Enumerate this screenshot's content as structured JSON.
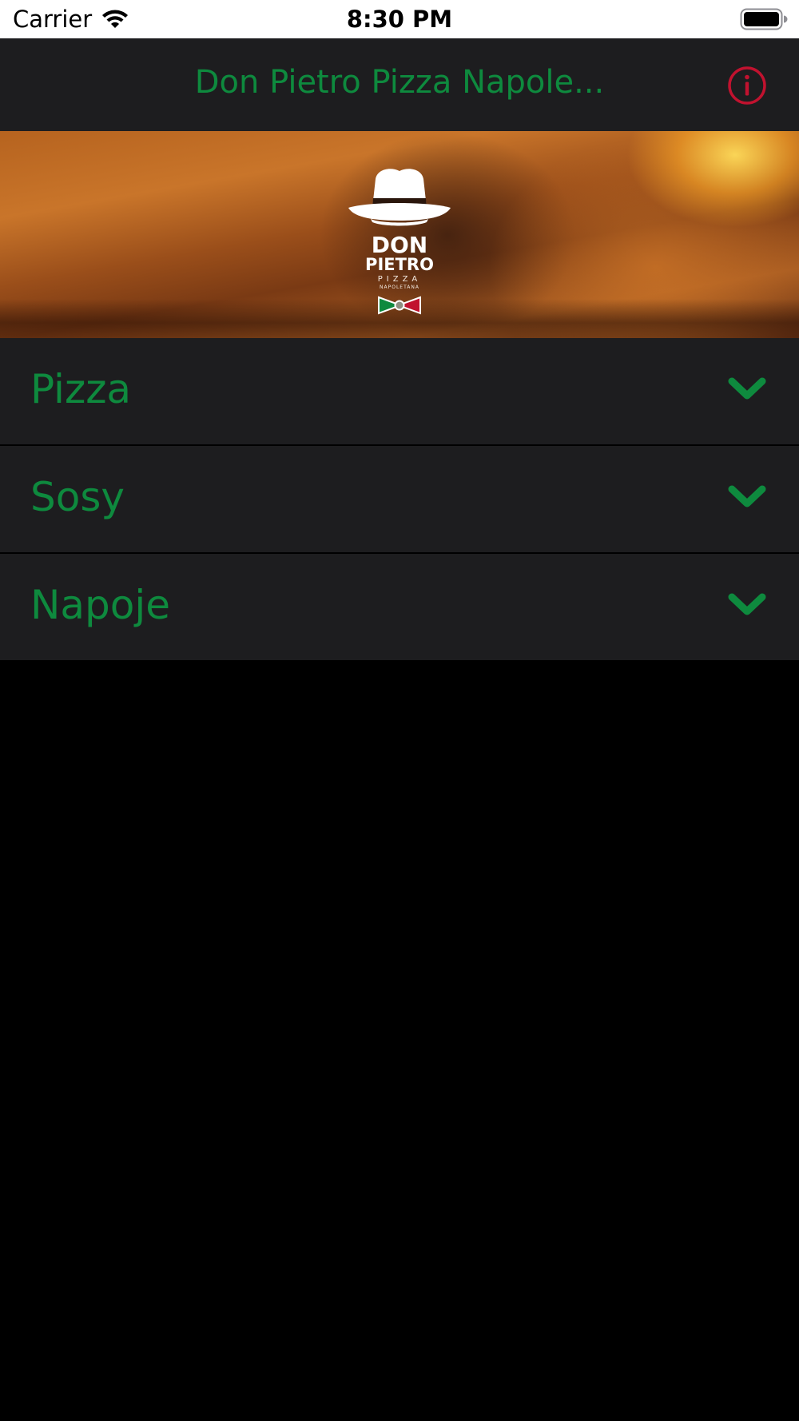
{
  "colors": {
    "accent_green": "#0e8a3e",
    "info_red": "#c1122f",
    "bar_bg": "#1d1d1f"
  },
  "status_bar": {
    "carrier": "Carrier",
    "time": "8:30 PM",
    "icons": [
      "wifi-icon",
      "battery-icon"
    ]
  },
  "nav": {
    "title": "Don Pietro Pizza Napole...",
    "info_icon": "info-circle-icon"
  },
  "banner": {
    "logo_lines": [
      "DON",
      "PIETRO",
      "PIZZA",
      "NAPOLETANA"
    ]
  },
  "menu": {
    "items": [
      {
        "label": "Pizza",
        "icon": "chevron-down-icon"
      },
      {
        "label": "Sosy",
        "icon": "chevron-down-icon"
      },
      {
        "label": "Napoje",
        "icon": "chevron-down-icon"
      }
    ]
  }
}
